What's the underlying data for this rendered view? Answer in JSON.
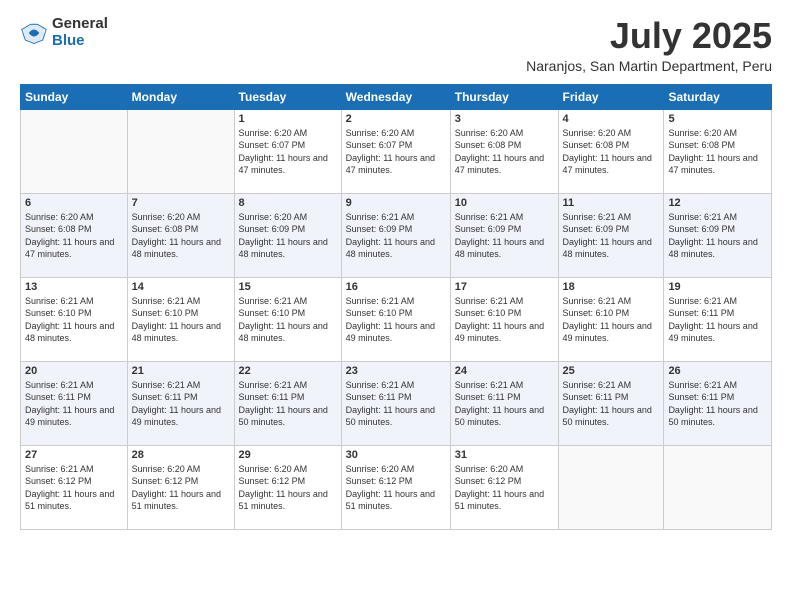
{
  "logo": {
    "general": "General",
    "blue": "Blue"
  },
  "header": {
    "month": "July 2025",
    "location": "Naranjos, San Martin Department, Peru"
  },
  "weekdays": [
    "Sunday",
    "Monday",
    "Tuesday",
    "Wednesday",
    "Thursday",
    "Friday",
    "Saturday"
  ],
  "weeks": [
    [
      {
        "day": "",
        "info": ""
      },
      {
        "day": "",
        "info": ""
      },
      {
        "day": "1",
        "info": "Sunrise: 6:20 AM\nSunset: 6:07 PM\nDaylight: 11 hours and 47 minutes."
      },
      {
        "day": "2",
        "info": "Sunrise: 6:20 AM\nSunset: 6:07 PM\nDaylight: 11 hours and 47 minutes."
      },
      {
        "day": "3",
        "info": "Sunrise: 6:20 AM\nSunset: 6:08 PM\nDaylight: 11 hours and 47 minutes."
      },
      {
        "day": "4",
        "info": "Sunrise: 6:20 AM\nSunset: 6:08 PM\nDaylight: 11 hours and 47 minutes."
      },
      {
        "day": "5",
        "info": "Sunrise: 6:20 AM\nSunset: 6:08 PM\nDaylight: 11 hours and 47 minutes."
      }
    ],
    [
      {
        "day": "6",
        "info": "Sunrise: 6:20 AM\nSunset: 6:08 PM\nDaylight: 11 hours and 47 minutes."
      },
      {
        "day": "7",
        "info": "Sunrise: 6:20 AM\nSunset: 6:08 PM\nDaylight: 11 hours and 48 minutes."
      },
      {
        "day": "8",
        "info": "Sunrise: 6:20 AM\nSunset: 6:09 PM\nDaylight: 11 hours and 48 minutes."
      },
      {
        "day": "9",
        "info": "Sunrise: 6:21 AM\nSunset: 6:09 PM\nDaylight: 11 hours and 48 minutes."
      },
      {
        "day": "10",
        "info": "Sunrise: 6:21 AM\nSunset: 6:09 PM\nDaylight: 11 hours and 48 minutes."
      },
      {
        "day": "11",
        "info": "Sunrise: 6:21 AM\nSunset: 6:09 PM\nDaylight: 11 hours and 48 minutes."
      },
      {
        "day": "12",
        "info": "Sunrise: 6:21 AM\nSunset: 6:09 PM\nDaylight: 11 hours and 48 minutes."
      }
    ],
    [
      {
        "day": "13",
        "info": "Sunrise: 6:21 AM\nSunset: 6:10 PM\nDaylight: 11 hours and 48 minutes."
      },
      {
        "day": "14",
        "info": "Sunrise: 6:21 AM\nSunset: 6:10 PM\nDaylight: 11 hours and 48 minutes."
      },
      {
        "day": "15",
        "info": "Sunrise: 6:21 AM\nSunset: 6:10 PM\nDaylight: 11 hours and 48 minutes."
      },
      {
        "day": "16",
        "info": "Sunrise: 6:21 AM\nSunset: 6:10 PM\nDaylight: 11 hours and 49 minutes."
      },
      {
        "day": "17",
        "info": "Sunrise: 6:21 AM\nSunset: 6:10 PM\nDaylight: 11 hours and 49 minutes."
      },
      {
        "day": "18",
        "info": "Sunrise: 6:21 AM\nSunset: 6:10 PM\nDaylight: 11 hours and 49 minutes."
      },
      {
        "day": "19",
        "info": "Sunrise: 6:21 AM\nSunset: 6:11 PM\nDaylight: 11 hours and 49 minutes."
      }
    ],
    [
      {
        "day": "20",
        "info": "Sunrise: 6:21 AM\nSunset: 6:11 PM\nDaylight: 11 hours and 49 minutes."
      },
      {
        "day": "21",
        "info": "Sunrise: 6:21 AM\nSunset: 6:11 PM\nDaylight: 11 hours and 49 minutes."
      },
      {
        "day": "22",
        "info": "Sunrise: 6:21 AM\nSunset: 6:11 PM\nDaylight: 11 hours and 50 minutes."
      },
      {
        "day": "23",
        "info": "Sunrise: 6:21 AM\nSunset: 6:11 PM\nDaylight: 11 hours and 50 minutes."
      },
      {
        "day": "24",
        "info": "Sunrise: 6:21 AM\nSunset: 6:11 PM\nDaylight: 11 hours and 50 minutes."
      },
      {
        "day": "25",
        "info": "Sunrise: 6:21 AM\nSunset: 6:11 PM\nDaylight: 11 hours and 50 minutes."
      },
      {
        "day": "26",
        "info": "Sunrise: 6:21 AM\nSunset: 6:11 PM\nDaylight: 11 hours and 50 minutes."
      }
    ],
    [
      {
        "day": "27",
        "info": "Sunrise: 6:21 AM\nSunset: 6:12 PM\nDaylight: 11 hours and 51 minutes."
      },
      {
        "day": "28",
        "info": "Sunrise: 6:20 AM\nSunset: 6:12 PM\nDaylight: 11 hours and 51 minutes."
      },
      {
        "day": "29",
        "info": "Sunrise: 6:20 AM\nSunset: 6:12 PM\nDaylight: 11 hours and 51 minutes."
      },
      {
        "day": "30",
        "info": "Sunrise: 6:20 AM\nSunset: 6:12 PM\nDaylight: 11 hours and 51 minutes."
      },
      {
        "day": "31",
        "info": "Sunrise: 6:20 AM\nSunset: 6:12 PM\nDaylight: 11 hours and 51 minutes."
      },
      {
        "day": "",
        "info": ""
      },
      {
        "day": "",
        "info": ""
      }
    ]
  ]
}
